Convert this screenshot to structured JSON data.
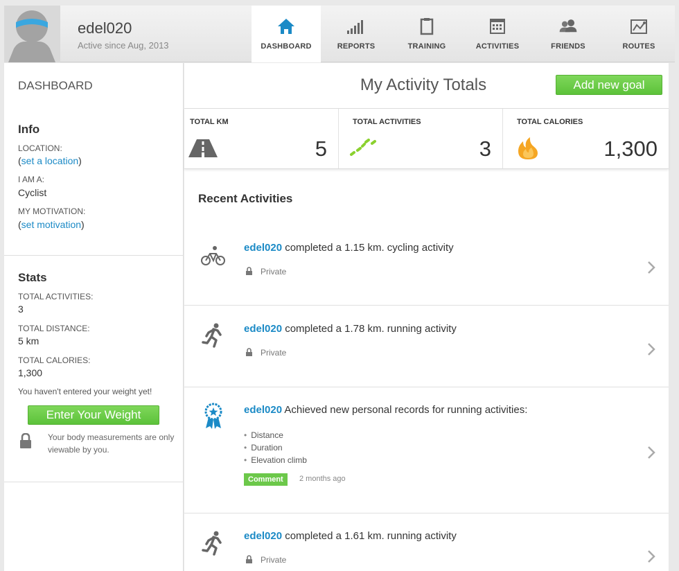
{
  "header": {
    "username": "edel020",
    "active_since": "Active since Aug, 2013",
    "tabs": [
      {
        "label": "DASHBOARD",
        "icon": "home-icon",
        "active": true
      },
      {
        "label": "REPORTS",
        "icon": "bar-chart-icon",
        "active": false
      },
      {
        "label": "TRAINING",
        "icon": "clipboard-icon",
        "active": false
      },
      {
        "label": "ACTIVITIES",
        "icon": "calendar-icon",
        "active": false
      },
      {
        "label": "FRIENDS",
        "icon": "people-icon",
        "active": false
      },
      {
        "label": "ROUTES",
        "icon": "map-icon",
        "active": false
      }
    ]
  },
  "sidebar": {
    "title": "DASHBOARD",
    "info": {
      "heading": "Info",
      "location_label": "LOCATION:",
      "location_link": "set a location",
      "i_am_label": "I AM A:",
      "i_am_value": "Cyclist",
      "motivation_label": "MY MOTIVATION:",
      "motivation_link": "set motivation",
      "paren_open": "(",
      "paren_close": ")"
    },
    "stats": {
      "heading": "Stats",
      "total_activities_label": "TOTAL ACTIVITIES:",
      "total_activities_value": "3",
      "total_distance_label": "TOTAL DISTANCE:",
      "total_distance_value": "5 km",
      "total_calories_label": "TOTAL CALORIES:",
      "total_calories_value": "1,300"
    },
    "weight_note": "You haven't entered your weight yet!",
    "weight_button": "Enter Your Weight",
    "body_note": "Your body measurements are only viewable by you."
  },
  "main": {
    "title": "My Activity Totals",
    "goal_button": "Add new goal",
    "totals": [
      {
        "label": "TOTAL KM",
        "value": "5",
        "icon": "road-icon"
      },
      {
        "label": "TOTAL ACTIVITIES",
        "value": "3",
        "icon": "dashes-icon"
      },
      {
        "label": "TOTAL CALORIES",
        "value": "1,300",
        "icon": "flame-icon"
      }
    ],
    "recent_title": "Recent Activities",
    "activities": [
      {
        "user": "edel020",
        "text": " completed a 1.15 km. cycling activity",
        "privacy": "Private",
        "icon": "bicycle-icon"
      },
      {
        "user": "edel020",
        "text": " completed a 1.78 km. running activity",
        "privacy": "Private",
        "icon": "runner-icon"
      },
      {
        "user": "edel020",
        "text": " Achieved new personal records for running activities:",
        "icon": "award-ribbon-icon",
        "records": [
          "Distance",
          "Duration",
          "Elevation climb"
        ],
        "comment": "Comment",
        "time": "2 months ago"
      },
      {
        "user": "edel020",
        "text": " completed a 1.61 km. running activity",
        "privacy": "Private",
        "icon": "runner-icon"
      }
    ]
  },
  "colors": {
    "accent_blue": "#1b8ac6",
    "button_green": "#6cc84a",
    "flame_orange": "#f5a623",
    "dash_green": "#8bd12f"
  }
}
